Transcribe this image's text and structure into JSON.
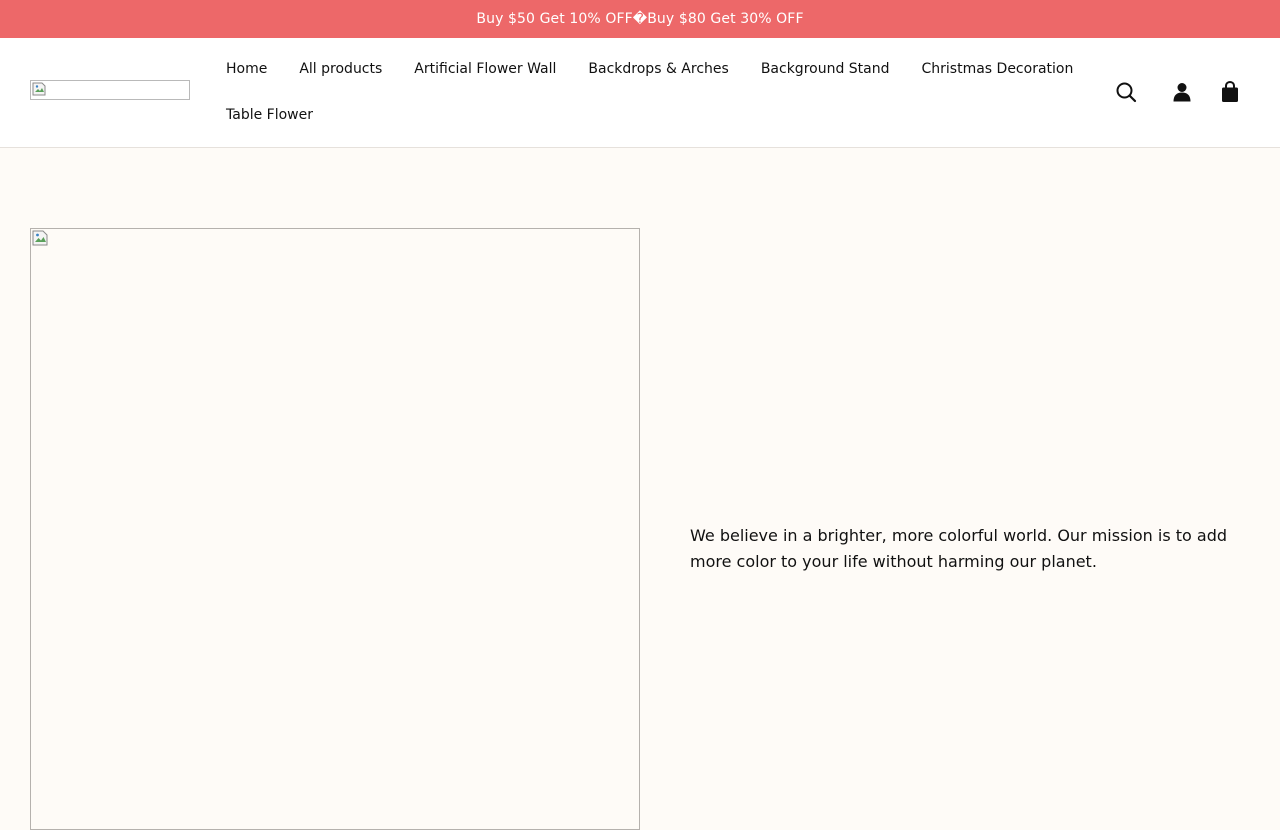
{
  "announcement": {
    "text": "Buy $50 Get 10% OFF�Buy $80 Get 30% OFF"
  },
  "header": {
    "logo_alt": "",
    "nav": {
      "row1": [
        "Home",
        "All products",
        "Artificial Flower Wall",
        "Backdrops & Arches",
        "Background Stand",
        "Christmas Decoration"
      ],
      "row2": [
        "Table Flower"
      ]
    },
    "icons": [
      "search-icon",
      "account-icon",
      "cart-icon"
    ]
  },
  "colors": {
    "announcement_bg": "#ed6869",
    "page_bg": "#fefbf7",
    "header_bg": "#ffffff"
  },
  "main": {
    "mission_text": "We believe in a brighter, more colorful world. Our mission is to add more color to your life without harming our planet."
  }
}
